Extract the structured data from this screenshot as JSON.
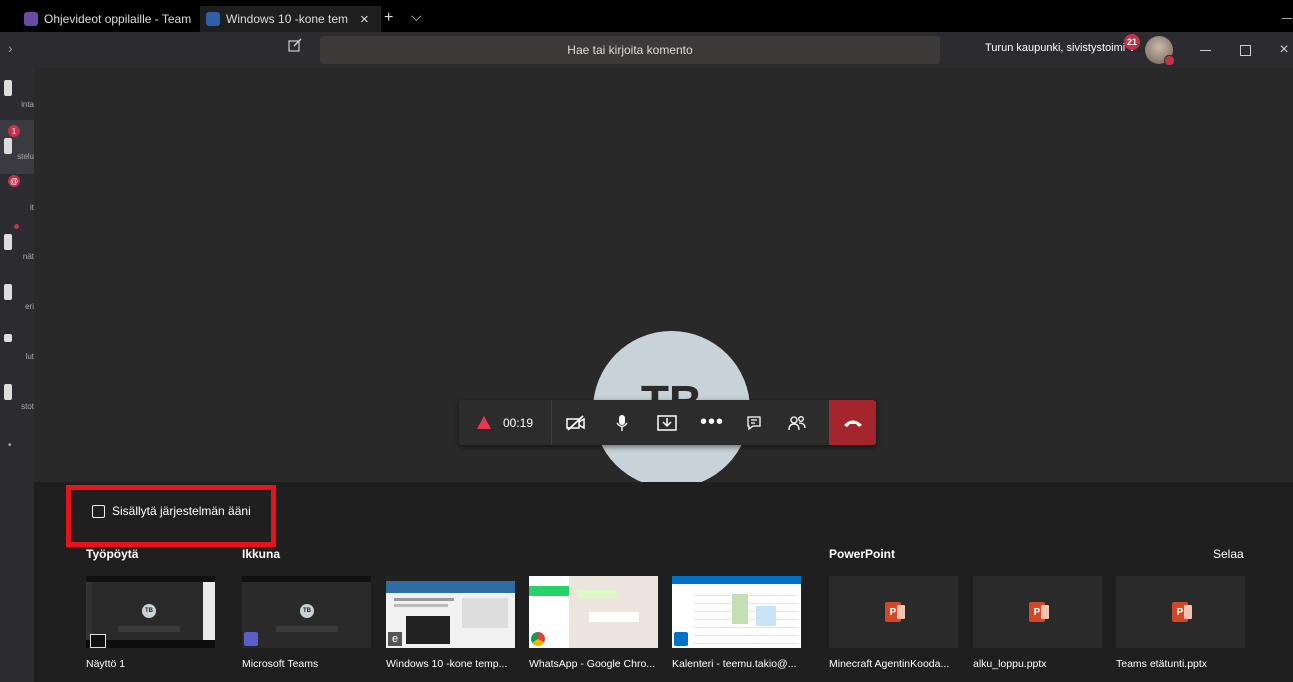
{
  "browser": {
    "tabs": [
      {
        "label": "Ohjevideot oppilaille - Team",
        "active": false
      },
      {
        "label": "Windows 10 -kone tem",
        "active": true
      }
    ],
    "close_glyph": "×",
    "new_tab_glyph": "+",
    "tab_list_glyph": "⌵"
  },
  "header": {
    "search_placeholder": "Hae tai kirjoita komento",
    "organization": "Turun kaupunki, sivistystoimi",
    "notification_count": "21"
  },
  "rail": {
    "items": [
      {
        "label": "inta",
        "badge": ""
      },
      {
        "label": "stelu",
        "badge": "1"
      },
      {
        "label": "it",
        "badge": "@"
      },
      {
        "label": "nät",
        "badge": ""
      },
      {
        "label": "eri",
        "badge": ""
      },
      {
        "label": "lut",
        "badge": ""
      },
      {
        "label": "stot",
        "badge": ""
      }
    ]
  },
  "call": {
    "participant_initials": "TB",
    "duration": "00:19"
  },
  "share": {
    "include_system_audio_label": "Sisällytä järjestelmän ääni",
    "include_system_audio_checked": false,
    "sections": {
      "desktop": "Työpöytä",
      "window": "Ikkuna",
      "powerpoint": "PowerPoint",
      "browse": "Selaa"
    },
    "items": [
      {
        "label": "Näyttö 1",
        "kind": "desktop"
      },
      {
        "label": "Microsoft Teams",
        "kind": "window"
      },
      {
        "label": "Windows 10 -kone temp...",
        "kind": "window"
      },
      {
        "label": "WhatsApp - Google Chro...",
        "kind": "window"
      },
      {
        "label": "Kalenteri - teemu.takio@...",
        "kind": "window"
      },
      {
        "label": "Minecraft AgentinKooda...",
        "kind": "powerpoint"
      },
      {
        "label": "alku_loppu.pptx",
        "kind": "powerpoint"
      },
      {
        "label": "Teams etätunti.pptx",
        "kind": "powerpoint"
      }
    ],
    "thumb_initials": "TB"
  },
  "colors": {
    "accent_red": "#e8121b",
    "hangup": "#a4262c",
    "badge": "#c4314b",
    "stage": "#292929"
  }
}
